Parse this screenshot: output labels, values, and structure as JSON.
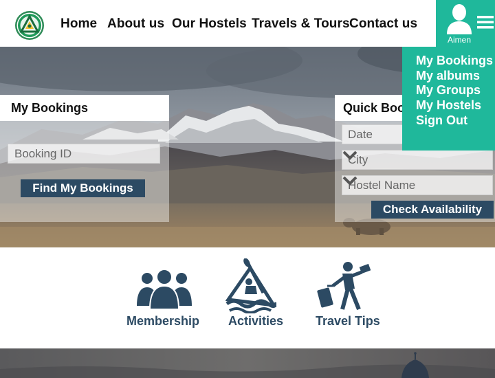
{
  "header": {
    "logo_icon": "triangle-emblem-icon",
    "nav": {
      "home": "Home",
      "about": "About us",
      "hostels": "Our Hostels",
      "travels": "Travels & Tours",
      "contact": "Contact us"
    },
    "user": {
      "name": "Aimen",
      "avatar_icon": "user-avatar-icon",
      "menu_icon": "hamburger-menu-icon"
    }
  },
  "user_menu": {
    "items": [
      "My Bookings",
      "My albums",
      "My Groups",
      "My Hostels",
      "Sign Out"
    ]
  },
  "bookings_panel": {
    "title": "My Bookings",
    "booking_id_placeholder": "Booking ID",
    "button": "Find My Bookings"
  },
  "quick_panel": {
    "title": "Quick Boo",
    "date_placeholder": "Date",
    "city_placeholder": "City",
    "hostel_placeholder": "Hostel Name",
    "button": "Check Availability"
  },
  "features": {
    "membership": "Membership",
    "activities": "Activities",
    "travel_tips": "Travel Tips"
  },
  "colors": {
    "accent": "#1fb89b",
    "button": "#2c4a63",
    "feature_text": "#2c4a63"
  }
}
